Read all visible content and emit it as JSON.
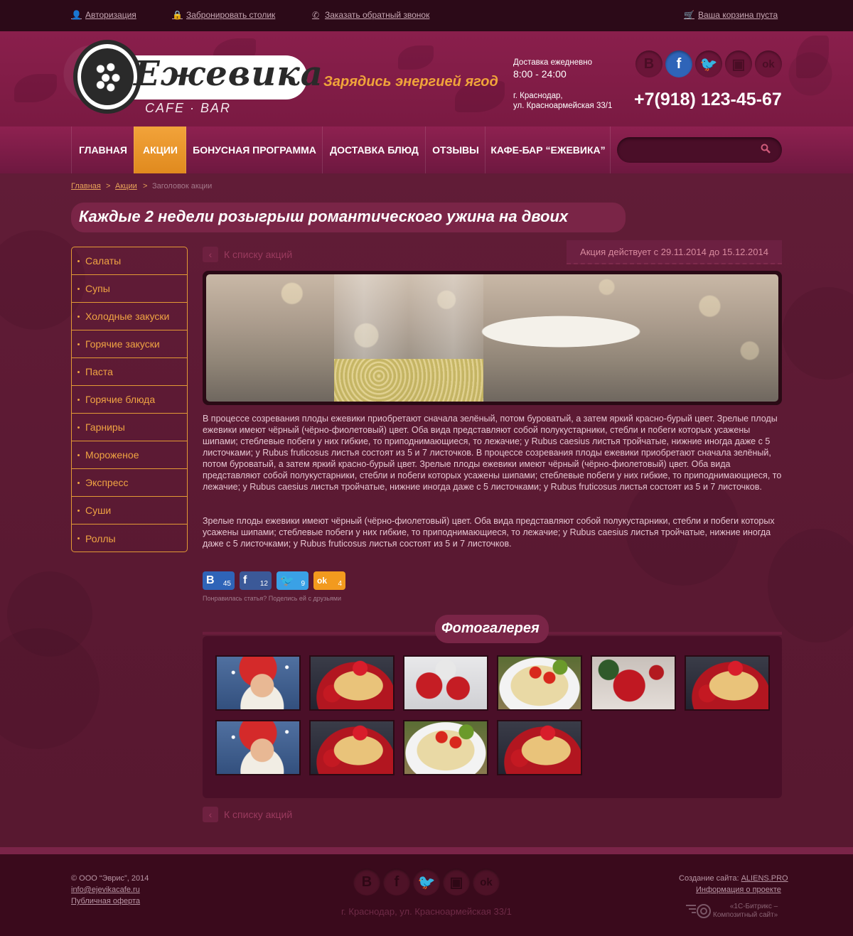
{
  "topbar": {
    "auth": "Авторизация",
    "reserve": "Забронировать столик",
    "callback": "Заказать обратный звонок",
    "cart": "Ваша корзина пуста"
  },
  "header": {
    "logo_text": "Ежевика",
    "logo_sub": "CAFE · BAR",
    "slogan": "Зарядись энергией ягод",
    "delivery_label": "Доставка ежедневно",
    "delivery_hours": "8:00 - 24:00",
    "city": "г. Краснодар,",
    "street": "ул. Красноармейская 33/1",
    "phone": "+7(918) 123-45-67",
    "social": [
      {
        "icon": "vk-icon",
        "glyph": "B"
      },
      {
        "icon": "facebook-icon",
        "glyph": "f"
      },
      {
        "icon": "twitter-icon",
        "glyph": "🐦"
      },
      {
        "icon": "instagram-icon",
        "glyph": "▣"
      },
      {
        "icon": "odnoklassniki-icon",
        "glyph": "ok"
      }
    ]
  },
  "nav": {
    "items": [
      "ГЛАВНАЯ",
      "АКЦИИ",
      "БОНУСНАЯ ПРОГРАММА",
      "ДОСТАВКА БЛЮД",
      "ОТЗЫВЫ",
      "КАФЕ-БАР “ЕЖЕВИКА”"
    ],
    "active_index": 1
  },
  "search": {
    "placeholder": ""
  },
  "breadcrumb": {
    "home": "Главная",
    "promos": "Акции",
    "sep": ">",
    "current": "Заголовок акции"
  },
  "page": {
    "title": "Каждые 2 недели розыгрыш романтического ужина на двоих",
    "back_link": "К списку акций",
    "dates": "Акция действует с 29.11.2014 до 15.12.2014",
    "paragraphs": [
      "В процессе созревания плоды ежевики приобретают сначала зелёный, потом буроватый, а затем яркий красно-бурый цвет. Зрелые плоды ежевики имеют чёрный (чёрно-фиолетовый) цвет. Оба вида представляют собой полукустарники, стебли и побеги которых усажены шипами; стеблевые побеги у них гибкие, то приподнимающиеся, то лежачие; у Rubus caesius листья тройчатые, нижние иногда даже с 5 листочками; у Rubus fruticosus листья состоят из 5 и 7 листочков. В процессе созревания плоды ежевики приобретают сначала зелёный, потом буроватый, а затем яркий красно-бурый цвет. Зрелые плоды ежевики имеют чёрный (чёрно-фиолетовый) цвет. Оба вида представляют собой полукустарники, стебли и побеги которых усажены шипами; стеблевые побеги у них гибкие, то приподнимающиеся, то лежачие; у Rubus caesius листья тройчатые, нижние иногда даже с 5 листочками; у Rubus fruticosus листья состоят из 5 и 7 листочков.",
      "Зрелые плоды ежевики имеют чёрный (чёрно-фиолетовый) цвет. Оба вида представляют собой полукустарники, стебли и побеги которых усажены шипами; стеблевые побеги у них гибкие, то приподнимающиеся, то лежачие; у Rubus caesius листья тройчатые, нижние иногда даже с 5 листочками; у Rubus fruticosus листья состоят из 5 и 7 листочков."
    ]
  },
  "share": {
    "buttons": [
      {
        "icon": "vk-icon",
        "glyph": "B",
        "count": "45",
        "color": "#2f64b8"
      },
      {
        "icon": "facebook-icon",
        "glyph": "f",
        "count": "12",
        "color": "#3b5998"
      },
      {
        "icon": "twitter-icon",
        "glyph": "🐦",
        "count": "9",
        "color": "#3aa1e6"
      },
      {
        "icon": "odnoklassniki-icon",
        "glyph": "ok",
        "count": "4",
        "color": "#f29a1e"
      }
    ],
    "note": "Понравилась статья? Поделись ей с друзьями"
  },
  "menu": {
    "items": [
      "Салаты",
      "Супы",
      "Холодные закуски",
      "Горячие закуски",
      "Паста",
      "Горячие блюда",
      "Гарниры",
      "Мороженое",
      "Экспресс",
      "Суши",
      "Роллы"
    ]
  },
  "gallery": {
    "title": "Фотогалерея",
    "items": [
      "santa-girl",
      "pancakes",
      "gifts",
      "pasta",
      "christmas-star",
      "pancakes",
      "santa-girl",
      "pancakes",
      "pasta",
      "pancakes"
    ]
  },
  "footer": {
    "copyright": "© ООО “Эврис”, 2014",
    "email": "info@ejevikacafe.ru",
    "offer": "Публичная оферта",
    "address": "г. Краснодар, ул. Красноармейская 33/1",
    "created_label": "Создание сайта:",
    "created_by": "ALIENS.PRO",
    "project_info": "Информация о проекте",
    "bitrix_line1": "«1С-Битрикс –",
    "bitrix_line2": "Композитный сайт»"
  },
  "colors": {
    "accent": "#f0a443",
    "brand": "#8a1f4c",
    "active_social": "#2f64b8"
  }
}
